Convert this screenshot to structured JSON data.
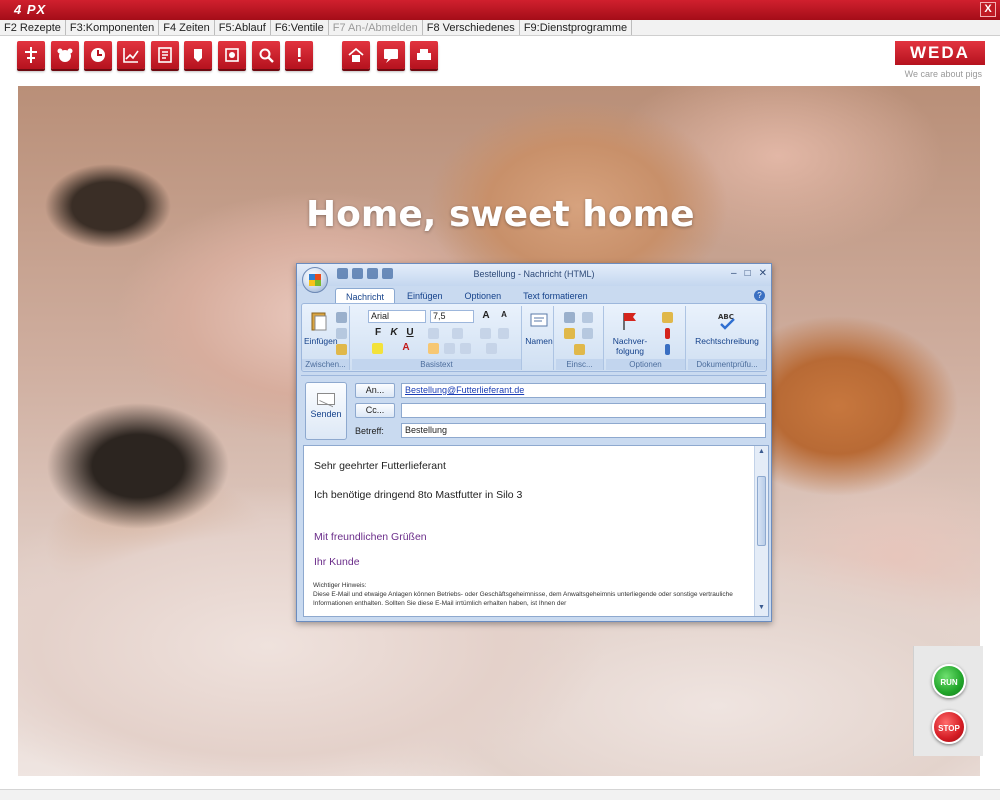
{
  "app": {
    "title": "4 PX",
    "close_label": "X"
  },
  "menu": [
    {
      "label": "F2 Rezepte",
      "disabled": false
    },
    {
      "label": "F3:Komponenten",
      "disabled": false
    },
    {
      "label": "F4 Zeiten",
      "disabled": false
    },
    {
      "label": "F5:Ablauf",
      "disabled": false
    },
    {
      "label": "F6:Ventile",
      "disabled": false
    },
    {
      "label": "F7 An-/Abmelden",
      "disabled": true
    },
    {
      "label": "F8 Verschiedenes",
      "disabled": false
    },
    {
      "label": "F9:Dienstprogramme",
      "disabled": false
    }
  ],
  "toolbar_icons": [
    "valve-icon",
    "pig-icon",
    "clock-icon",
    "chart-icon",
    "recipe-icon",
    "silo-icon",
    "component-icon",
    "search-icon",
    "alarm-icon",
    "home-icon",
    "message-icon",
    "printer-icon"
  ],
  "brand": {
    "logo": "WEDA",
    "tagline": "We care about pigs",
    "color": "#c4141f"
  },
  "headline": "Home, sweet home",
  "mail": {
    "window_title": "Bestellung - Nachricht (HTML)",
    "tabs": [
      "Nachricht",
      "Einfügen",
      "Optionen",
      "Text formatieren"
    ],
    "active_tab": "Nachricht",
    "ribbon": {
      "paste": "Einfügen",
      "clipboard_group": "Zwischen...",
      "font_name": "Arial",
      "font_size": "7,5",
      "basic_text_group": "Basistext",
      "names": "Namen",
      "include_group": "Einsc...",
      "followup_line1": "Nachver-",
      "followup_line2": "folgung",
      "options_group": "Optionen",
      "spelling": "Rechtschreibung",
      "proofing_group": "Dokumentprüfu..."
    },
    "send_label": "Senden",
    "to_button": "An...",
    "cc_button": "Cc...",
    "subject_label": "Betreff:",
    "to_value": "Bestellung@Futterlieferant.de",
    "cc_value": "",
    "subject_value": "Bestellung",
    "body": {
      "greeting": "Sehr geehrter Futterlieferant",
      "request": "Ich benötige dringend 8to Mastfutter in Silo 3",
      "closing": "Mit freundlichen Grüßen",
      "signature": "Ihr Kunde",
      "disclaimer_title": "Wichtiger Hinweis:",
      "disclaimer_text": "Diese E-Mail und etwaige Anlagen können Betriebs- oder Geschäftsgeheimnisse, dem Anwaltsgeheimnis unterliegende oder sonstige vertrauliche Informationen enthalten. Sollten Sie diese E-Mail irrtümlich erhalten haben, ist Ihnen der"
    }
  },
  "controls": {
    "run": "RUN",
    "stop": "STOP"
  }
}
